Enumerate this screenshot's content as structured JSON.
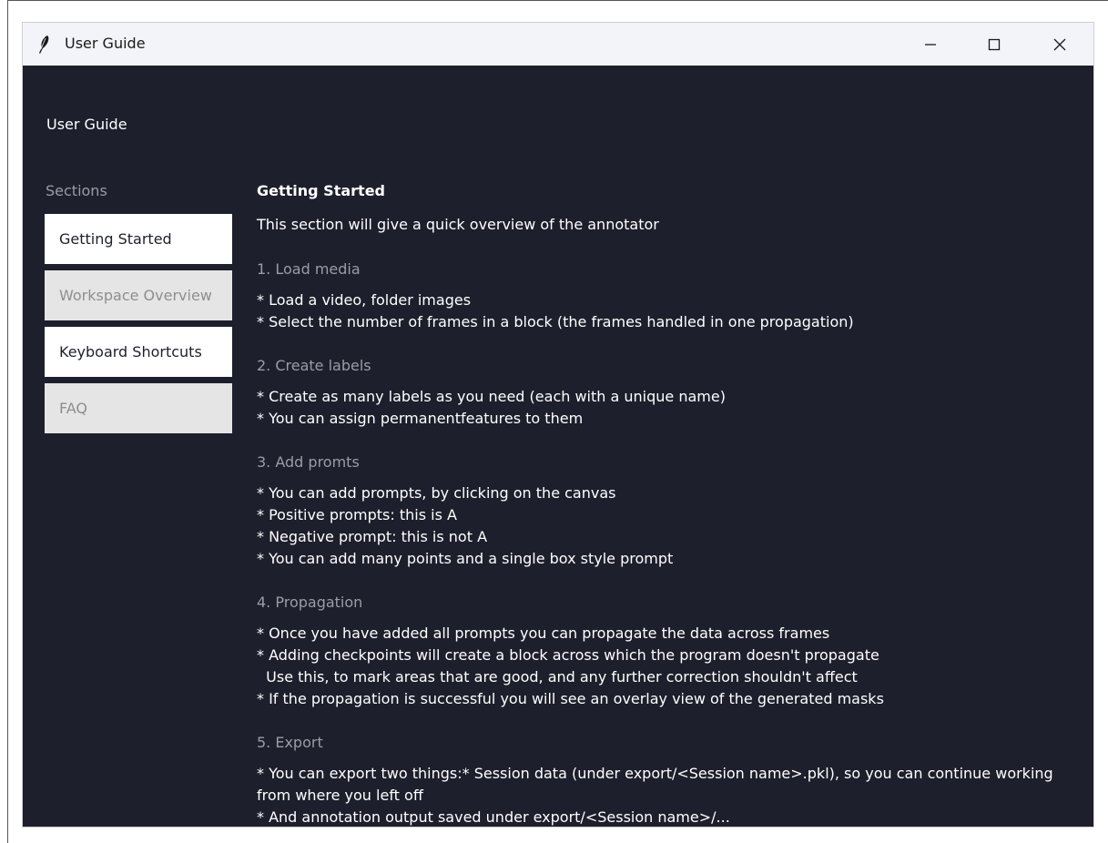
{
  "window": {
    "title": "User Guide",
    "controls": {
      "minimize": "minimize-icon",
      "maximize": "maximize-icon",
      "close": "close-icon"
    },
    "icon": "feather-icon"
  },
  "header": {
    "title": "User Guide"
  },
  "sidebar": {
    "label": "Sections",
    "items": [
      {
        "label": "Getting Started",
        "state": "active"
      },
      {
        "label": "Workspace Overview",
        "state": "inactive"
      },
      {
        "label": "Keyboard Shortcuts",
        "state": "active"
      },
      {
        "label": "FAQ",
        "state": "inactive"
      }
    ]
  },
  "main": {
    "title": "Getting Started",
    "intro": "This section will give a quick overview of the annotator",
    "sections": [
      {
        "heading": "1. Load media",
        "lines": [
          "* Load a video, folder images",
          "* Select the number of frames in a block (the frames handled in one propagation)"
        ]
      },
      {
        "heading": "2. Create labels",
        "lines": [
          "* Create as many labels as you need (each with a unique name)",
          "* You can assign permanentfeatures to them"
        ]
      },
      {
        "heading": "3. Add promts",
        "lines": [
          "* You can add prompts, by clicking on the canvas",
          "* Positive prompts: this is A",
          "* Negative prompt: this is not A",
          "* You can add many points and a single box style prompt"
        ]
      },
      {
        "heading": "4. Propagation",
        "lines": [
          "* Once you have added all prompts you can propagate the data across frames",
          "* Adding checkpoints will create a block across which the program doesn't propagate",
          "  Use this, to mark areas that are good, and any further correction shouldn't affect",
          "* If the propagation is successful you will see an overlay view of the generated masks"
        ]
      },
      {
        "heading": "5. Export",
        "lines": [
          "* You can export two things:* Session data (under export/<Session name>.pkl), so you can continue working",
          "from where you left off",
          "* And annotation output saved under export/<Session name>/..."
        ]
      }
    ]
  }
}
